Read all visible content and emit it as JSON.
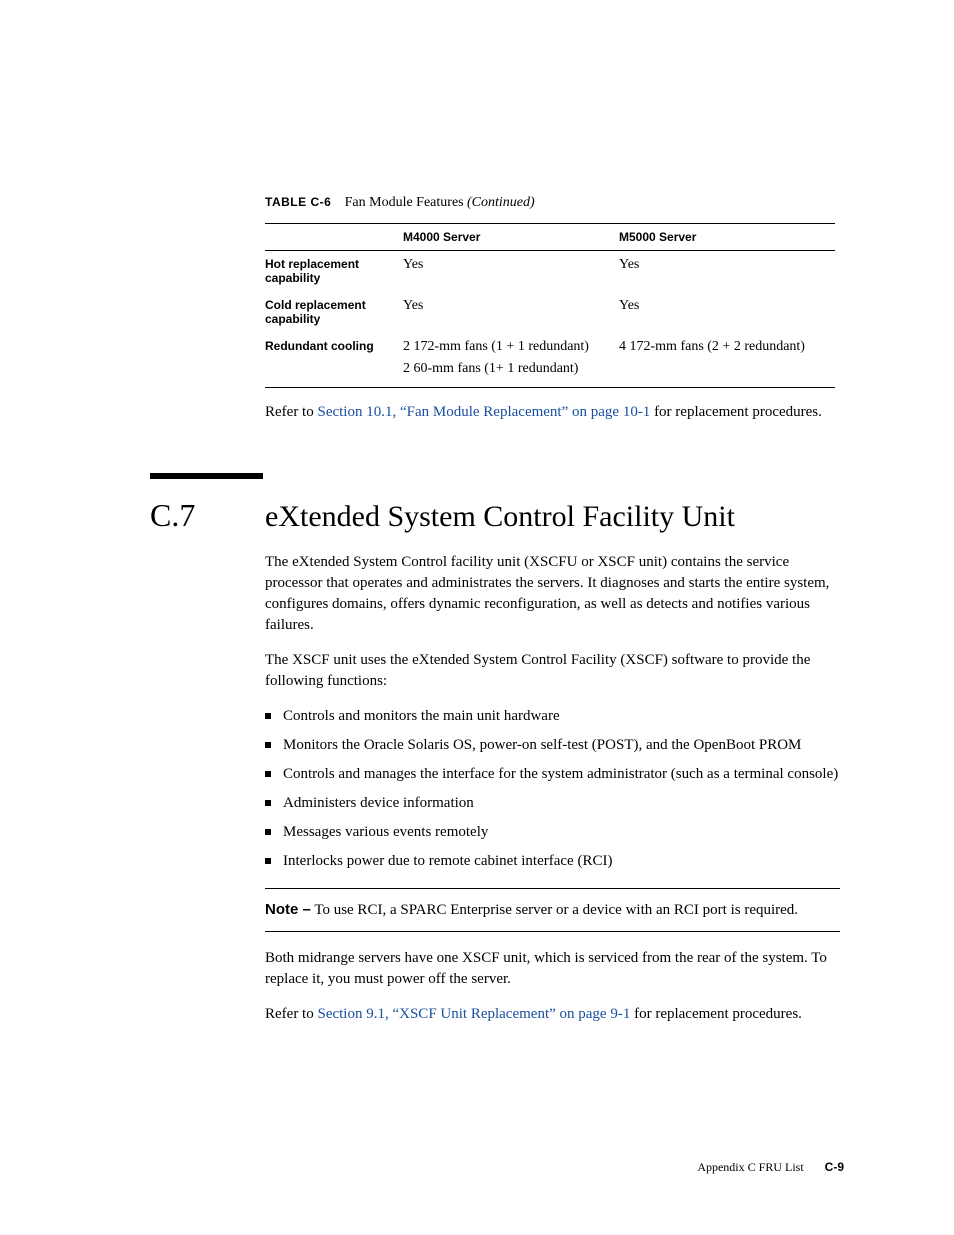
{
  "table": {
    "label": "TABLE C-6",
    "title": "Fan Module Features",
    "continued": "(Continued)",
    "headers": [
      "",
      "M4000 Server",
      "M5000 Server"
    ],
    "rows": [
      {
        "label": "Hot replacement capability",
        "c1": "Yes",
        "c2": "Yes"
      },
      {
        "label": "Cold replacement capability",
        "c1": "Yes",
        "c2": "Yes"
      },
      {
        "label": "Redundant cooling",
        "c1": "2 172-mm fans (1 + 1 redundant)",
        "c1b": "2 60-mm fans (1+ 1 redundant)",
        "c2": "4 172-mm fans (2 + 2 redundant)"
      }
    ]
  },
  "para_refer_10": {
    "pre": "Refer to ",
    "link": "Section 10.1, “Fan Module Replacement” on page 10-1",
    "post": " for replacement procedures."
  },
  "section": {
    "num": "C.7",
    "title": "eXtended System Control Facility Unit"
  },
  "para_intro": "The eXtended System Control facility unit (XSCFU or XSCF unit) contains the service processor that operates and administrates the servers. It diagnoses and starts the entire system, configures domains, offers dynamic reconfiguration, as well as detects and notifies various failures.",
  "para_func": "The XSCF unit uses the eXtended System Control Facility (XSCF) software to provide the following functions:",
  "bullets": [
    "Controls and monitors the main unit hardware",
    "Monitors the Oracle Solaris OS, power-on self-test (POST), and the OpenBoot PROM",
    "Controls and manages the interface for the system administrator (such as a terminal console)",
    "Administers device information",
    "Messages various events remotely",
    "Interlocks power due to remote cabinet interface (RCI)"
  ],
  "note": {
    "label": "Note –",
    "text": " To use RCI, a SPARC Enterprise server or a device with an RCI port is required."
  },
  "para_both": "Both midrange servers have one XSCF unit, which is serviced from the rear of the system. To replace it, you must power off the server.",
  "para_refer_9": {
    "pre": "Refer to ",
    "link": "Section 9.1, “XSCF Unit Replacement” on page 9-1",
    "post": " for replacement procedures."
  },
  "footer": {
    "appendix": "Appendix C    FRU List",
    "pagenum": "C-9"
  }
}
